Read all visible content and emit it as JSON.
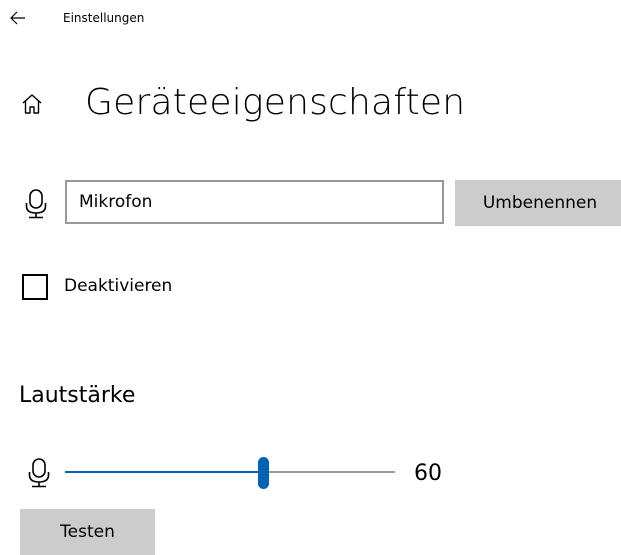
{
  "header": {
    "back_icon": "arrow-left-icon",
    "app_title": "Einstellungen"
  },
  "page": {
    "home_icon": "home-icon",
    "title": "Geräteeigenschaften"
  },
  "device_name": {
    "icon": "microphone-icon",
    "value": "Mikrofon",
    "rename_label": "Umbenennen"
  },
  "disable": {
    "label": "Deaktivieren",
    "checked": false
  },
  "volume": {
    "section_title": "Lautstärke",
    "icon": "microphone-icon",
    "value": 60,
    "value_label": "60",
    "test_label": "Testen"
  },
  "colors": {
    "accent": "#0063b1",
    "button_bg": "#cccccc",
    "border": "#999999"
  }
}
